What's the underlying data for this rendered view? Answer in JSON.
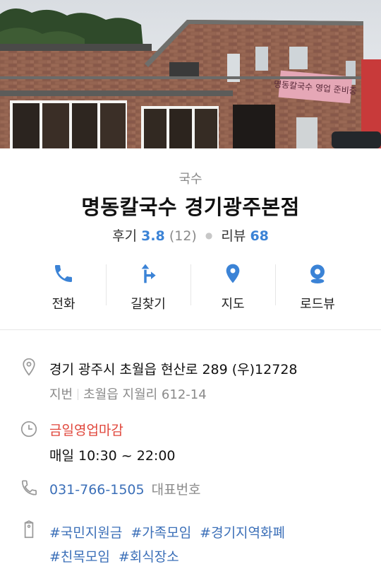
{
  "place": {
    "category": "국수",
    "name": "명동칼국수 경기광주본점",
    "review_label": "후기",
    "rating": "3.8",
    "rating_count": "(12)",
    "blog_label": "리뷰",
    "blog_count": "68",
    "sign_text": "명동칼국수 영업 준비중"
  },
  "actions": [
    {
      "label": "전화",
      "icon": "phone-icon"
    },
    {
      "label": "길찾기",
      "icon": "directions-icon"
    },
    {
      "label": "지도",
      "icon": "map-pin-icon"
    },
    {
      "label": "로드뷰",
      "icon": "roadview-icon"
    }
  ],
  "address": {
    "road": "경기 광주시 초월읍 현산로 289 (우)12728",
    "jibun_label": "지번",
    "jibun": "초월읍 지월리 612-14"
  },
  "hours": {
    "status": "금일영업마감",
    "schedule": "매일 10:30 ~ 22:00"
  },
  "phone": {
    "number": "031-766-1505",
    "type": "대표번호"
  },
  "tags": [
    "#국민지원금",
    "#가족모임",
    "#경기지역화폐",
    "#친목모임",
    "#회식장소"
  ],
  "colors": {
    "accent": "#3b83d6",
    "closed": "#e0463b",
    "link": "#3b6fb8",
    "muted": "#8a8a8a",
    "icon_gray": "#999999"
  }
}
